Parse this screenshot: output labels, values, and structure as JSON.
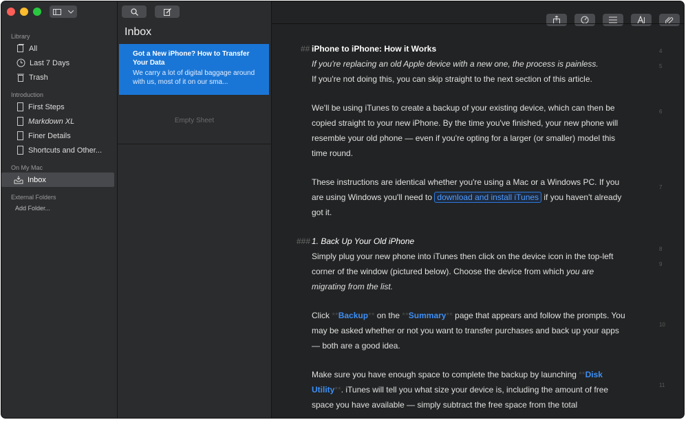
{
  "sidebar": {
    "library_label": "Library",
    "library_items": [
      "All",
      "Last 7 Days",
      "Trash"
    ],
    "introduction_label": "Introduction",
    "introduction_items": [
      "First Steps",
      "Markdown XL",
      "Finer Details",
      "Shortcuts and Other..."
    ],
    "on_my_mac_label": "On My Mac",
    "on_my_mac_items": [
      "Inbox"
    ],
    "external_label": "External Folders",
    "add_folder": "Add Folder..."
  },
  "sheet_list": {
    "title": "Inbox",
    "selected_title": "Got a New iPhone? How to Transfer Your Data",
    "selected_preview": "We carry a lot of digital baggage around with us, most of it on our sma...",
    "empty_label": "Empty Sheet"
  },
  "editor": {
    "h2_mark": "##",
    "heading": "iPhone to iPhone: How it Works",
    "p1_a": "If you're replacing an old Apple device with a new one, the process is painless.",
    "p1_b": "If you're not doing this, you can skip straight to the next section of this article.",
    "p2": "We'll be using iTunes to create a backup of your existing device, which can then be copied straight to your new iPhone. By the time you've finished, your new phone will resemble your old phone — even if you're opting for a larger (or smaller) model this time round.",
    "p3_a": "These instructions are identical whether you're using a Mac or a Windows PC. If you are using Windows you'll need to ",
    "p3_link": "download and install iTunes",
    "p3_b": " if you haven't already got it.",
    "h3_mark": "###",
    "subheading": "1. Back Up Your Old iPhone",
    "p4_a": "Simply plug your new phone into iTunes then click on the device icon in the top-left corner of the window (pictured below). Choose the device from which ",
    "p4_em": "you are migrating from the list.",
    "p5_a": "Click ",
    "p5_mark": "**",
    "p5_backup": "Backup",
    "p5_b": " on the ",
    "p5_summary": "Summary",
    "p5_c": " page that appears and follow the prompts. You may be asked whether or not you want to transfer purchases and back up your apps — both are a good idea.",
    "p6_a": "Make sure you have enough space to complete the backup by launching ",
    "p6_disk": "Disk Utility",
    "p6_b": ". iTunes will tell you what size your device is, including the amount of free space you have available — simply subtract the free space from the total",
    "line_numbers": [
      "4",
      "5",
      "6",
      "7",
      "8",
      "9",
      "10",
      "11"
    ]
  }
}
